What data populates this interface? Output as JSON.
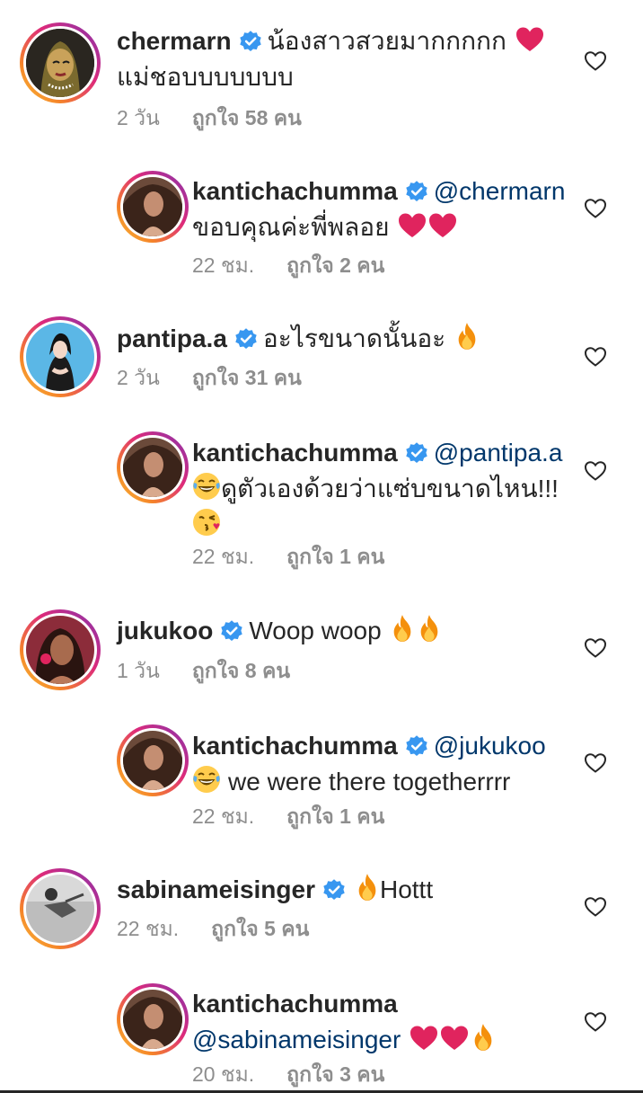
{
  "comments": [
    {
      "username": "chermarn",
      "text_line1": "น้องสาวสวยมากกกกก",
      "text_line2": "แม่ชอบบบบบบบ",
      "time": "2 วัน",
      "likes": "ถูกใจ 58 คน",
      "emoji": [
        "heart-emoji"
      ],
      "avatar": "cartoon-avatar"
    },
    {
      "username": "kantichachumma",
      "mention": "@chermarn",
      "text_line2": "ขอบคุณค่ะพี่พลอย",
      "time": "22 ชม.",
      "likes": "ถูกใจ 2 คน",
      "emoji": [
        "heart-emoji",
        "heart-emoji"
      ],
      "avatar": "photo-avatar"
    },
    {
      "username": "pantipa.a",
      "text_line1": "อะไรขนาดนั้นอะ",
      "time": "2 วัน",
      "likes": "ถูกใจ 31 คน",
      "emoji": [
        "fire-emoji"
      ],
      "avatar": "illustrated-avatar"
    },
    {
      "username": "kantichachumma",
      "mention": "@pantipa.a",
      "text_line2": "ดูตัวเองด้วยว่าแซ่บขนาดไหน!!!",
      "time": "22 ชม.",
      "likes": "ถูกใจ 1 คน",
      "emoji": [
        "laughing-emoji",
        "kiss-emoji"
      ],
      "avatar": "photo-avatar"
    },
    {
      "username": "jukukoo",
      "text_line1": "Woop woop",
      "time": "1 วัน",
      "likes": "ถูกใจ 8 คน",
      "emoji": [
        "fire-emoji",
        "fire-emoji"
      ],
      "avatar": "photo-avatar"
    },
    {
      "username": "kantichachumma",
      "mention": "@jukukoo",
      "text_line2": "we were there togetherrrr",
      "time": "22 ชม.",
      "likes": "ถูกใจ 1 คน",
      "emoji": [
        "laughing-emoji"
      ],
      "avatar": "photo-avatar"
    },
    {
      "username": "sabinameisinger",
      "text_line1": "Hottt",
      "time": "22 ชม.",
      "likes": "ถูกใจ 5 คน",
      "emoji": [
        "fire-emoji"
      ],
      "avatar": "bw-photo-avatar"
    },
    {
      "username": "kantichachumma",
      "mention": "@sabinameisinger",
      "time": "20 ชม.",
      "likes": "ถูกใจ 3 คน",
      "emoji": [
        "heart-emoji",
        "heart-emoji",
        "fire-emoji"
      ],
      "avatar": "photo-avatar"
    }
  ],
  "colors": {
    "text": "#262626",
    "meta": "#8e8e8e",
    "mention": "#00376b",
    "verified": "#3897f0",
    "heart_emoji": "#e0245e",
    "fire_emoji": "#f4900c"
  },
  "icons": {
    "like": "heart-outline-icon",
    "verified": "verified-badge-icon"
  }
}
